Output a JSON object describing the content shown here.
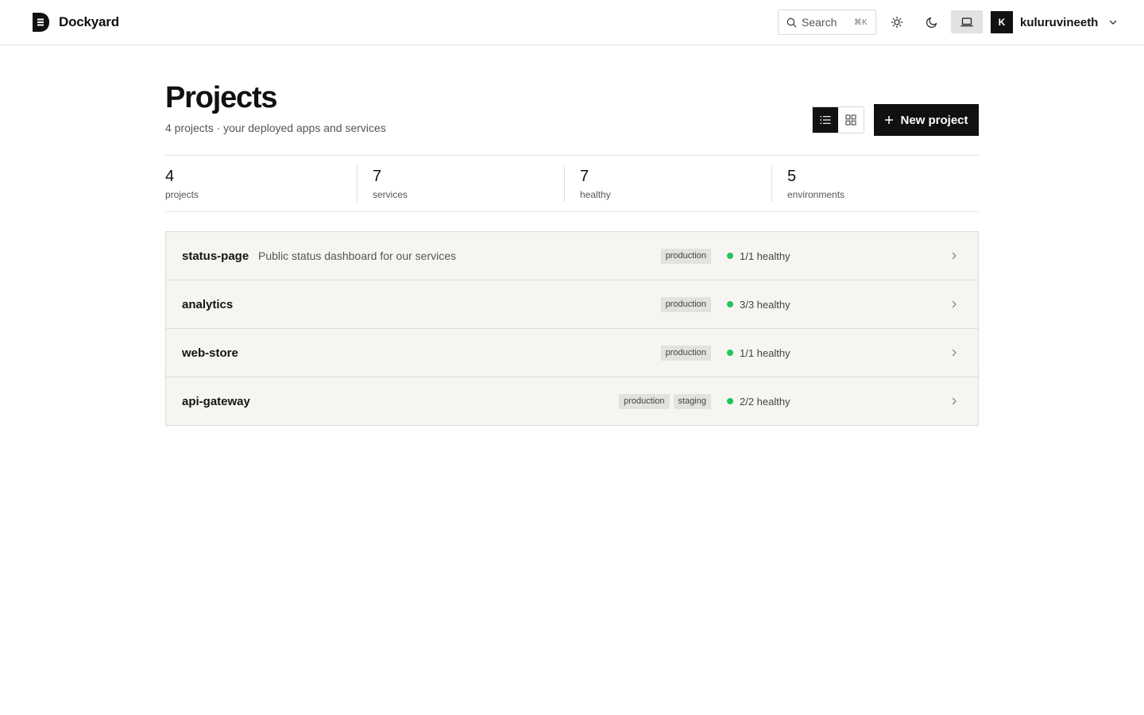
{
  "app": {
    "name": "Dockyard"
  },
  "search": {
    "placeholder": "Search",
    "shortcut": "⌘K"
  },
  "theme": {
    "active": "system"
  },
  "user": {
    "initial": "K",
    "name": "kuluruvineeth"
  },
  "page": {
    "title": "Projects",
    "subtitle": "4 projects · your deployed apps and services",
    "new_button_label": "New project",
    "view": "list"
  },
  "stats": [
    {
      "value": "4",
      "label": "projects"
    },
    {
      "value": "7",
      "label": "services"
    },
    {
      "value": "7",
      "label": "healthy"
    },
    {
      "value": "5",
      "label": "environments"
    }
  ],
  "projects": [
    {
      "name": "status-page",
      "description": "Public status dashboard for our services",
      "tags": [
        "production"
      ],
      "health": "1/1 healthy"
    },
    {
      "name": "analytics",
      "description": "",
      "tags": [
        "production"
      ],
      "health": "3/3 healthy"
    },
    {
      "name": "web-store",
      "description": "",
      "tags": [
        "production"
      ],
      "health": "1/1 healthy"
    },
    {
      "name": "api-gateway",
      "description": "",
      "tags": [
        "production",
        "staging"
      ],
      "health": "2/2 healthy"
    }
  ],
  "colors": {
    "accent": "#111111",
    "healthy": "#22c55e",
    "row_bg": "#f6f5f2",
    "tag_bg": "#e3e2de"
  }
}
